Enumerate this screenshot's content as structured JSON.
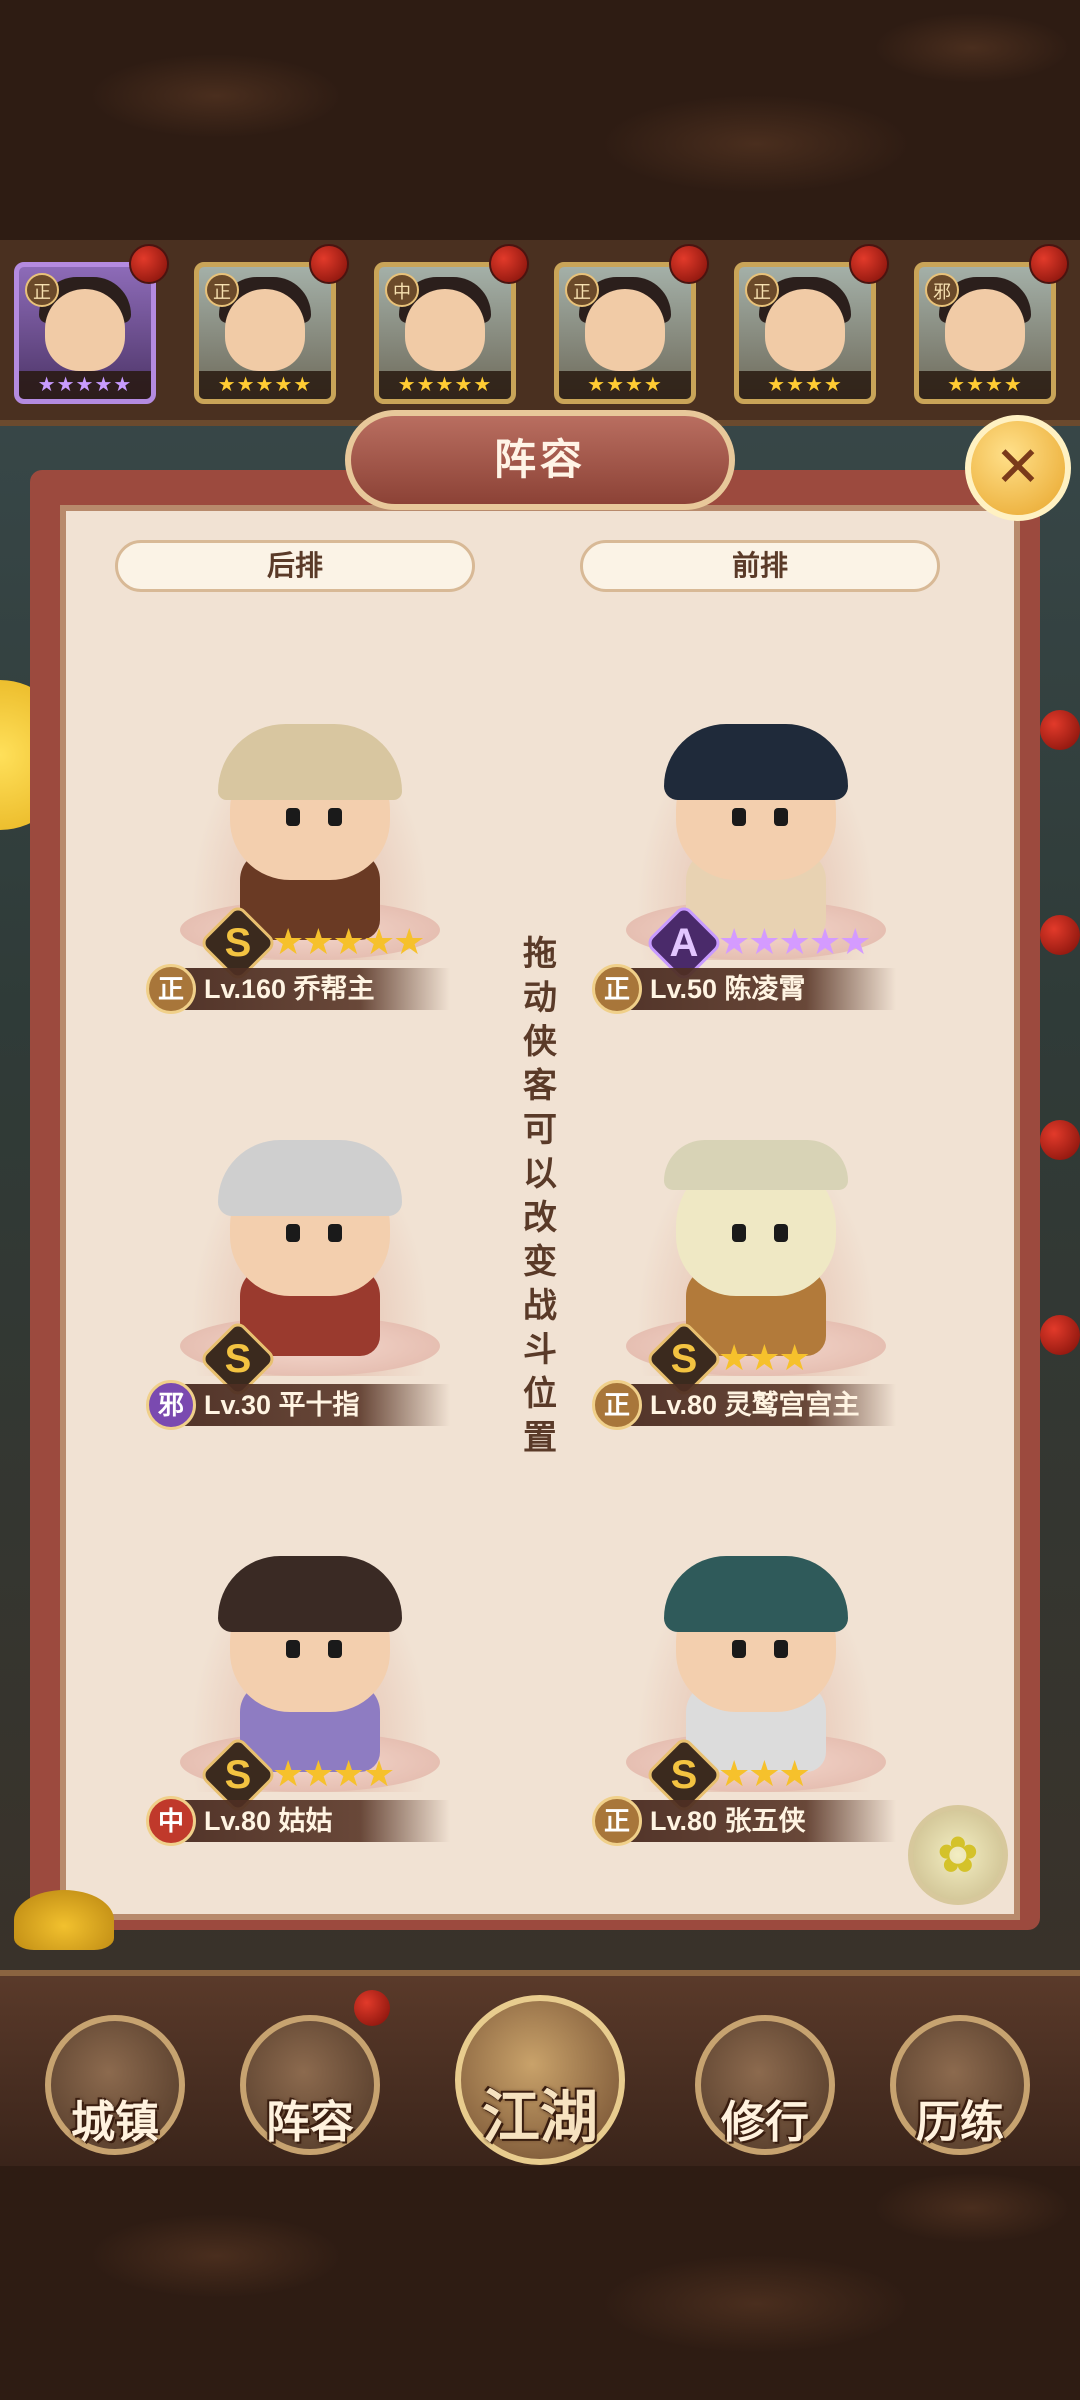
{
  "panel": {
    "title": "阵容",
    "close_icon": "close-icon"
  },
  "tabs": {
    "back_row": "后排",
    "front_row": "前排"
  },
  "hint": [
    "拖",
    "动",
    "侠",
    "客",
    "可",
    "以",
    "改",
    "变",
    "战",
    "斗",
    "位",
    "置"
  ],
  "roster": [
    {
      "faction": "正",
      "stars": "★★★★★",
      "selected": true
    },
    {
      "faction": "正",
      "stars": "★★★★★"
    },
    {
      "faction": "中",
      "stars": "★★★★★"
    },
    {
      "faction": "正",
      "stars": "★★★★"
    },
    {
      "faction": "正",
      "stars": "★★★★"
    },
    {
      "faction": "邪",
      "stars": "★★★★"
    }
  ],
  "heroes": [
    {
      "rank": "S",
      "stars": "★★★★★",
      "faction": "正",
      "level": "Lv.160",
      "name": "乔帮主",
      "text": "Lv.160 乔帮主"
    },
    {
      "rank": "A",
      "stars": "★★★★★",
      "faction": "正",
      "level": "Lv.50",
      "name": "陈凌霄",
      "text": "Lv.50 陈凌霄"
    },
    {
      "rank": "S",
      "stars": "",
      "faction": "邪",
      "level": "Lv.30",
      "name": "平十指",
      "text": "Lv.30 平十指"
    },
    {
      "rank": "S",
      "stars": "★★★",
      "faction": "正",
      "level": "Lv.80",
      "name": "灵鹫宫宫主",
      "text": "Lv.80 灵鹫宫宫主"
    },
    {
      "rank": "S",
      "stars": "★★★★",
      "faction": "中",
      "level": "Lv.80",
      "name": "姑姑",
      "text": "Lv.80 姑姑"
    },
    {
      "rank": "S",
      "stars": "★★★",
      "faction": "正",
      "level": "Lv.80",
      "name": "张五侠",
      "text": "Lv.80 张五侠"
    }
  ],
  "nav": {
    "town": "城镇",
    "lineup": "阵容",
    "jianghu": "江湖",
    "training": "修行",
    "trials": "历练"
  },
  "colors": {
    "panel_bg": "#f1e2d3",
    "frame": "#9c4a3e",
    "gold_star": "#f6c12c",
    "purple_star": "#d49bff"
  }
}
